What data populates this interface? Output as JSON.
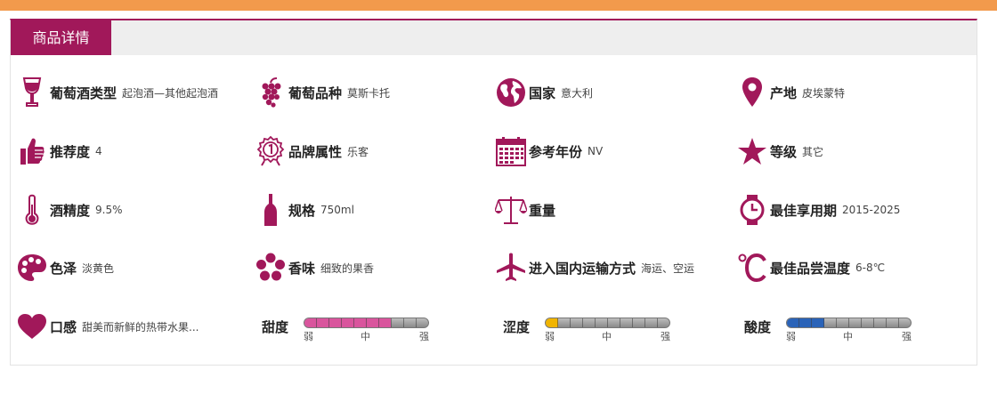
{
  "tab_title": "商品详情",
  "colors": {
    "accent": "#a1185a",
    "topbar": "#f29a4c",
    "tab_bar": "#eeeeee"
  },
  "attributes": [
    {
      "icon": "wine-glass-icon",
      "label": "葡萄酒类型",
      "value": "起泡酒—其他起泡酒"
    },
    {
      "icon": "grape-icon",
      "label": "葡萄品种",
      "value": "莫斯卡托"
    },
    {
      "icon": "globe-icon",
      "label": "国家",
      "value": "意大利"
    },
    {
      "icon": "location-pin-icon",
      "label": "产地",
      "value": "皮埃蒙特"
    },
    {
      "icon": "thumbs-up-icon",
      "label": "推荐度",
      "value": "4"
    },
    {
      "icon": "medal-icon",
      "label": "品牌属性",
      "value": "乐客"
    },
    {
      "icon": "calendar-icon",
      "label": "参考年份",
      "value": "NV"
    },
    {
      "icon": "star-icon",
      "label": "等级",
      "value": "其它"
    },
    {
      "icon": "thermometer-icon",
      "label": "酒精度",
      "value": "9.5%"
    },
    {
      "icon": "bottle-icon",
      "label": "规格",
      "value": "750ml"
    },
    {
      "icon": "scale-icon",
      "label": "重量",
      "value": ""
    },
    {
      "icon": "watch-icon",
      "label": "最佳享用期",
      "value": "2015-2025"
    },
    {
      "icon": "palette-icon",
      "label": "色泽",
      "value": "淡黄色"
    },
    {
      "icon": "flower-icon",
      "label": "香味",
      "value": "细致的果香"
    },
    {
      "icon": "airplane-icon",
      "label": "进入国内运输方式",
      "value": "海运、空运"
    },
    {
      "icon": "celsius-icon",
      "label": "最佳品尝温度",
      "value": "6-8℃"
    },
    {
      "icon": "heart-icon",
      "label": "口感",
      "value": "甜美而新鲜的热带水果..."
    }
  ],
  "meters": [
    {
      "label": "甜度",
      "level": 0.7,
      "color": "#d9559d",
      "scale": [
        "弱",
        "中",
        "强"
      ]
    },
    {
      "label": "涩度",
      "level": 0.1,
      "color": "#f0b400",
      "scale": [
        "弱",
        "中",
        "强"
      ]
    },
    {
      "label": "酸度",
      "level": 0.3,
      "color": "#2a63b8",
      "scale": [
        "弱",
        "中",
        "强"
      ]
    }
  ]
}
